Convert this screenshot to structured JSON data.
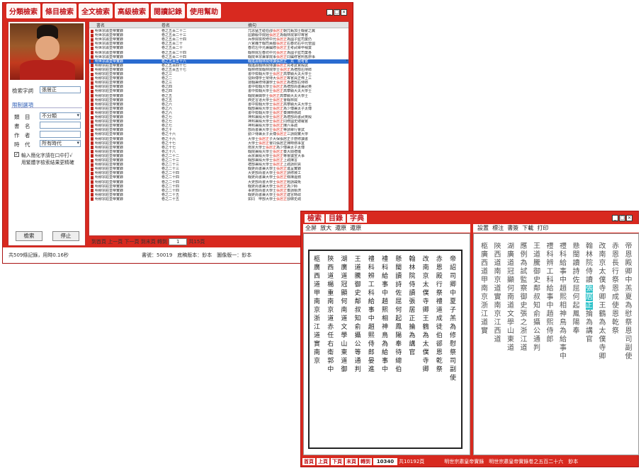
{
  "window1": {
    "toolbar": [
      "分類檢索",
      "條目檢索",
      "全文檢索",
      "高級檢索",
      "閱讀記錄",
      "使用幫助"
    ],
    "search": {
      "label": "檢索字詞",
      "value": "張居正"
    },
    "limit": {
      "title": "限制選項",
      "category_label": "類　目",
      "category_value": "不分類",
      "book_label": "書　名",
      "author_label": "作　者",
      "period_label": "時　代",
      "period_value": "所有時代"
    },
    "checkbox_label": "輸入簡化字請在口中打√",
    "checkbox_label2": "用繁體字檢索結果更精確",
    "buttons": {
      "search": "檢索",
      "stop": "停止"
    },
    "columns": [
      "書名",
      "卷名",
      "摘句"
    ],
    "rows": [
      [
        "明世宗肅皇帝實錄",
        "卷之五百二十二",
        "兀思猛王碰伯邵張居正朝兀甄加士翰翟之翼"
      ],
      [
        "明世宗肅皇帝實錄",
        "卷之五百二十三",
        "屈錄級中院經張居正為翰林院掌印等官"
      ],
      [
        "明世宗肅皇帝實錄",
        "卷之五百二十四",
        "兵恭院檢校修中允張居正為國子監司業仍"
      ],
      [
        "明世宗肅皇帝實錄",
        "卷之五百二十",
        "六官職于翰司黃都張居正右春坊右中允管國"
      ],
      [
        "明世宗肅皇帝實錄",
        "卷之五百二十",
        "春坊左中允兼編修張居正主考武舉卒稍賞"
      ],
      [
        "明世宗肅皇帝實錄",
        "卷之五百二十四",
        "翰林院左春坊中允張居正為國子監司業各"
      ],
      [
        "明世宗肅皇帝實錄",
        "卷之五百二十四",
        "翰院世宗兼掌院事張居正同編修官照舊辦事"
      ],
      [
        "明世宗肅皇帝實錄",
        "卷之五百五十六",
        "翰進肅翰林院侍讀張居正　充　校考官"
      ],
      [
        "明穆宗莊皇帝實錄",
        "卷之五百四十七",
        "翰進肅翰林院侍讀張居正充考試官殿試"
      ],
      [
        "明穆宗莊皇帝實錄",
        "卷之五百五十七",
        "翰林修撰翰林院學士張居正為禮部右侍郎"
      ],
      [
        "明穆宗莊皇帝實錄",
        "卷之三",
        "書中檢翰大學士張居正高攀顯大夫大學士"
      ],
      [
        "明穆宗莊皇帝實錄",
        "卷之二",
        "從師傅學士常侍大張居正等官員正俸上三"
      ],
      [
        "明穆宗莊皇帝實錄",
        "卷之三",
        "運翰兼修侍讀學士張居正為禮部右侍郎"
      ],
      [
        "明穆宗莊皇帝實錄",
        "卷之四",
        "書中檢翰大學士張居正為禮部尚書兼武英"
      ],
      [
        "明穆宗莊皇帝實錄",
        "卷之四",
        "書中檢翰大學士張居正高攀顯大夫大學士"
      ],
      [
        "明穆宗莊皇帝實錄",
        "卷之五",
        "翰院兼閣學士張居正高攀顯大夫大學士"
      ],
      [
        "明穆宗莊皇帝實錄",
        "卷之五",
        "西史言道大學士張居正會翰林院"
      ],
      [
        "明穆宗莊皇帝實錄",
        "卷之六",
        "書中檢翰大學士張居正高攀顯大夫大學士"
      ],
      [
        "明穆宗莊皇帝實錄",
        "卷之六",
        "翰部兼殿大學士張居正為少傅兼太子太傅"
      ],
      [
        "明穆宗莊皇帝實錄",
        "卷之六",
        "書中檢翰大學士張居正奏陳時務疏"
      ],
      [
        "明穆宗莊皇帝實錄",
        "卷之七",
        "神邦兼殿大學士張居正為禮部尚書武英殿"
      ],
      [
        "明穆宗莊皇帝實錄",
        "卷之七",
        "神邦兼殿大學士張居正同修國史總裁官"
      ],
      [
        "明穆宗莊皇帝實錄",
        "卷之七",
        "神邦兼殿大學士張居正陳六事疏"
      ],
      [
        "明穆宗莊皇帝實錄",
        "卷之十",
        "部尚書兼大學士張居正等請舉行會試"
      ],
      [
        "明穆宗莊皇帝實錄",
        "卷之十六",
        "勤少傳兼太子太傅張居正三請閱實大學"
      ],
      [
        "明穆宗莊皇帝實錄",
        "卷之十六",
        "大學士張居正子大保張居正子懋修讀書"
      ],
      [
        "明穆宗莊皇帝實錄",
        "卷之十七",
        "大學士張居正會同張居正陳時務事宜"
      ],
      [
        "明穆宗莊皇帝實錄",
        "卷之十七",
        "南京大學士張居正為少傅兼太子太傅"
      ],
      [
        "明穆宗莊皇帝實錄",
        "卷之十八",
        "翰院兼殿大學士張居正奏大閱禮儀"
      ],
      [
        "明穆宗莊皇帝實錄",
        "卷之二十二",
        "兩京兼殿大學士張居正等會議宣大事"
      ],
      [
        "明穆宗莊皇帝實錄",
        "卷之二十三",
        "翰部兼殿大學士張居正上疏陳言"
      ],
      [
        "明穆宗莊皇帝實錄",
        "卷之二十三",
        "禮部兼殿大學士張居正上疏請封貢"
      ],
      [
        "明穆宗莊皇帝實錄",
        "卷之二十三",
        "翰吏尚書兼大學士張居正進呈實錄"
      ],
      [
        "明穆宗莊皇帝實錄",
        "卷之二十四",
        "大吏部尚書大學士張居正請修陵工"
      ],
      [
        "明穆宗莊皇帝實錄",
        "卷之二十四",
        "翰吏尚書兼大學士張居正條陳邊務"
      ],
      [
        "明穆宗莊皇帝實錄",
        "卷之二十四",
        "大吏部尚書大學士張居正題請蠲免"
      ],
      [
        "明穆宗莊皇帝實錄",
        "卷之二十四",
        "翰吏尚書兼大學士張居正為少師"
      ],
      [
        "明穆宗莊皇帝實錄",
        "卷之二十四",
        "事吏部尚書大學士張居正奏請賑濟"
      ],
      [
        "明穆宗莊皇帝實錄",
        "卷之二十五",
        "翰吏尚書兼大學士張居正建言時政"
      ],
      [
        "明穆宗莊皇帝實錄",
        "卷之二十五",
        "如同　甲部大學士張居正卻御史疏"
      ]
    ],
    "nav": {
      "first": "到首頁",
      "prev": "上一頁",
      "next": "下一頁",
      "last": "到末頁",
      "goto": "轉到",
      "page": "1",
      "total": "共15頁"
    },
    "status": {
      "records": "共509條記錄，用時0.16秒",
      "book": "書號：50019　底稿版本：鈔本　圖像版一：鈔本"
    }
  },
  "window2": {
    "tabs": [
      "檢索",
      "目錄",
      "字典"
    ],
    "menu_left": [
      "全屏",
      "放大",
      "還原",
      "還原"
    ],
    "menu_right": [
      "設置",
      "標注",
      "書簽",
      "下載",
      "打印"
    ],
    "book_columns": [
      "帝詔司卿中夏子羔為修慰祭司副使",
      "赤恩殿行祭禮道成徒伯郤恩乾祭",
      "改南京太僕寺卿王鶴為太僕寺卿",
      "翰林院侍讀張居正　　掄　為講官",
      "懸閩讀詩佐屈何起鳳陽奉待總伯",
      "禮科給事中趙熙相神鳥為給事中",
      "禮科辨工科給事中趙熙侍郎晏進",
      "王道騰御史鄰叔知俞攝公等通判",
      "湖廣道冠顯何南道文學山東道御",
      "陝西道楊重南京道赤任右衛郭中",
      "柩廣西道甲南京浙江道實南京"
    ],
    "text_columns": [
      "帝恩殿卿中羔夏為慰祭恩司副使",
      "赤恩長行祭恩成使恩乾祭",
      "改南京太僕寺卿王鶴為太僕寺卿",
      "翰林院侍讀張居正　掄為講官",
      "懸閩讀詩佐屈何起鳳陽奉",
      "禮科給事中趙熙相神鳥為給事中",
      "禮科辨工科給事中趙熙侍郎",
      "王道騰御史鄰叔知俞攝公通判",
      "應例為試監察御史張之浙江道",
      "湖廣道冠顯何南道文學山東道",
      "陝西道南京道實南京江西道",
      "柩廣西道甲南京浙江道實"
    ],
    "highlight_text": "張居正",
    "footer_buttons": [
      "首頁",
      "上頁",
      "下頁",
      "末頁",
      "轉到"
    ],
    "footer_page": "10340",
    "footer_total": "共10192頁",
    "footer_title": "明世宗肅皇帝實錄　明世宗肅皇帝實錄卷之五百二十六　鈔本"
  }
}
